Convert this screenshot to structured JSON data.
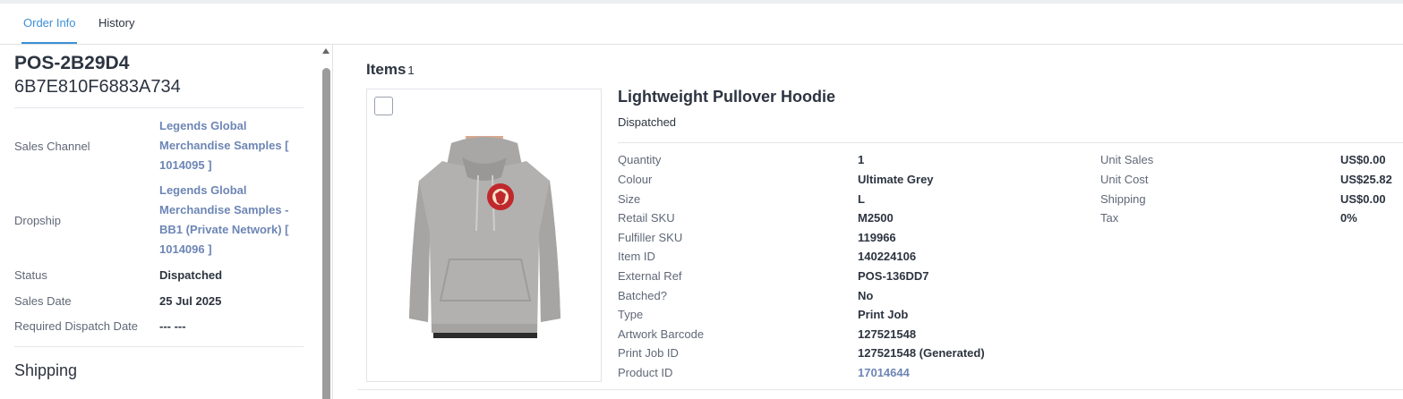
{
  "tabs": [
    {
      "label": "Order Info",
      "active": true
    },
    {
      "label": "History",
      "active": false
    }
  ],
  "order": {
    "ref": "POS-2B29D4",
    "id": "6B7E810F6883A734"
  },
  "fields": {
    "sales_channel_label": "Sales Channel",
    "sales_channel_lines": [
      "Legends Global",
      "Merchandise Samples [",
      "1014095 ]"
    ],
    "dropship_label": "Dropship",
    "dropship_lines": [
      "Legends Global",
      "Merchandise Samples -",
      "BB1 (Private Network) [",
      "1014096 ]"
    ],
    "status_label": "Status",
    "status_value": "Dispatched",
    "sales_date_label": "Sales Date",
    "sales_date_value": "25 Jul 2025",
    "required_dispatch_label": "Required Dispatch Date",
    "required_dispatch_value": "--- ---"
  },
  "shipping_section": "Shipping",
  "items": {
    "title": "Items",
    "count": "1"
  },
  "product": {
    "title": "Lightweight Pullover Hoodie",
    "status": "Dispatched",
    "details": [
      {
        "label": "Quantity",
        "value": "1"
      },
      {
        "label": "Colour",
        "value": "Ultimate Grey"
      },
      {
        "label": "Size",
        "value": "L"
      },
      {
        "label": "Retail SKU",
        "value": "M2500"
      },
      {
        "label": "Fulfiller SKU",
        "value": "119966"
      },
      {
        "label": "Item ID",
        "value": "140224106"
      },
      {
        "label": "External Ref",
        "value": "POS-136DD7"
      },
      {
        "label": "Batched?",
        "value": "No"
      },
      {
        "label": "Type",
        "value": "Print Job"
      },
      {
        "label": "Artwork Barcode",
        "value": "127521548"
      },
      {
        "label": "Print Job ID",
        "value": "127521548 (Generated)"
      },
      {
        "label": "Product ID",
        "value": "17014644"
      }
    ],
    "costs": [
      {
        "label": "Unit Sales",
        "value": "US$0.00"
      },
      {
        "label": "Unit Cost",
        "value": "US$25.82"
      },
      {
        "label": "Shipping",
        "value": "US$0.00"
      },
      {
        "label": "Tax",
        "value": "0%"
      }
    ]
  },
  "colors": {
    "accent": "#3d8fd6",
    "link": "#6d86b5",
    "hoodie": "#b3b1af",
    "logo": "#c0282d"
  }
}
